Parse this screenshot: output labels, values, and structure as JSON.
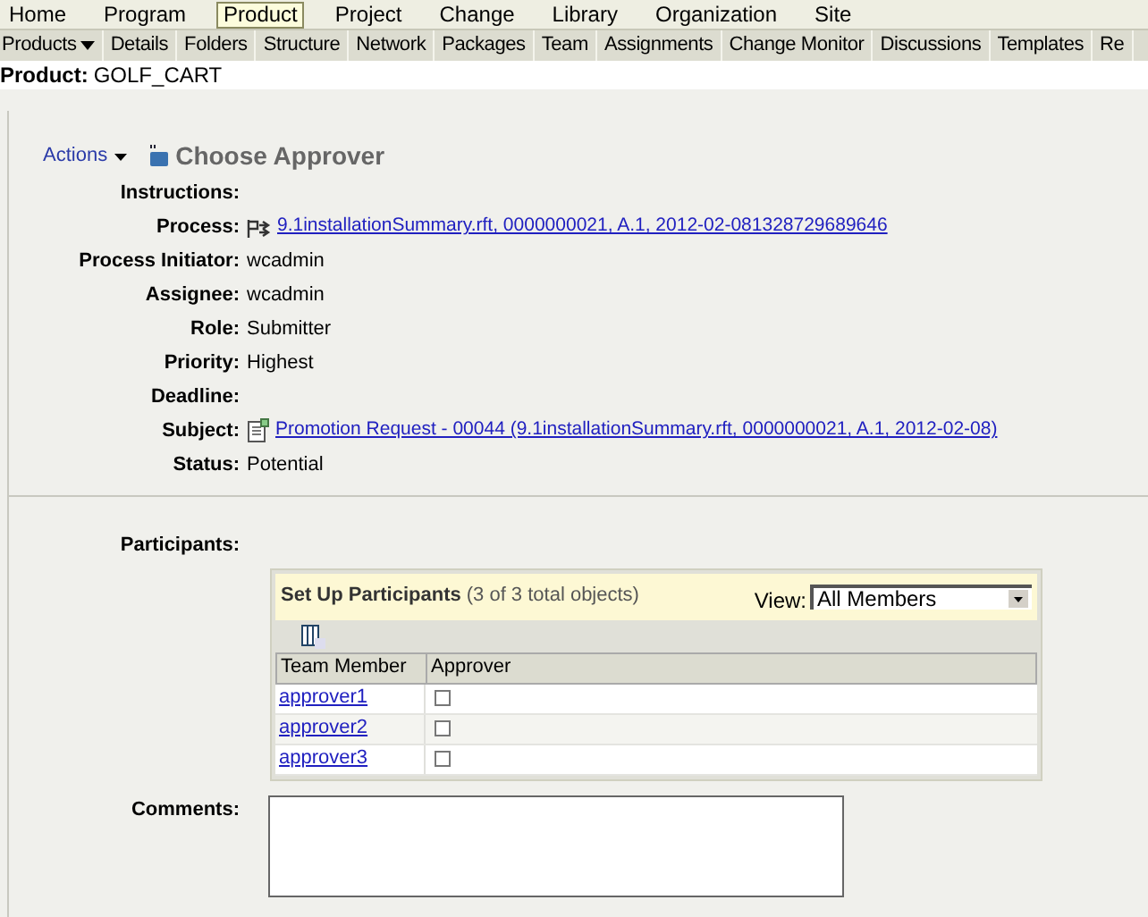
{
  "menu": [
    {
      "label": "Home",
      "selected": false
    },
    {
      "label": "Program",
      "selected": false
    },
    {
      "label": "Product",
      "selected": true
    },
    {
      "label": "Project",
      "selected": false
    },
    {
      "label": "Change",
      "selected": false
    },
    {
      "label": "Library",
      "selected": false
    },
    {
      "label": "Organization",
      "selected": false
    },
    {
      "label": "Site",
      "selected": false
    }
  ],
  "tabs": [
    {
      "label": "Products",
      "kind": "dropdown"
    },
    {
      "label": "Details",
      "kind": "tab"
    },
    {
      "label": "Folders",
      "kind": "tab"
    },
    {
      "label": "Structure",
      "kind": "tab"
    },
    {
      "label": "Network",
      "kind": "tab"
    },
    {
      "label": "Packages",
      "kind": "tab"
    },
    {
      "label": "Team",
      "kind": "tab"
    },
    {
      "label": "Assignments",
      "kind": "tab"
    },
    {
      "label": "Change Monitor",
      "kind": "tab"
    },
    {
      "label": "Discussions",
      "kind": "tab"
    },
    {
      "label": "Templates",
      "kind": "tab"
    },
    {
      "label": "Re",
      "kind": "tab"
    }
  ],
  "context": {
    "label": "Product:",
    "value": "GOLF_CART"
  },
  "actions": "Actions",
  "task_title": "Choose Approver",
  "fields": [
    {
      "label": "Instructions:",
      "kind": "text"
    },
    {
      "label": "Process:",
      "kind": "link",
      "value": "9.1installationSummary.rft, 0000000021, A.1, 2012-02-081328729689646"
    },
    {
      "label": "Process Initiator:",
      "kind": "text",
      "value": "wcadmin"
    },
    {
      "label": "Assignee:",
      "kind": "text",
      "value": "wcadmin"
    },
    {
      "label": "Role:",
      "kind": "text",
      "value": "Submitter"
    },
    {
      "label": "Priority:",
      "kind": "text",
      "value": "Highest"
    },
    {
      "label": "Deadline:",
      "kind": "text"
    },
    {
      "label": "Subject:",
      "kind": "doclink",
      "value": "Promotion Request - 00044 (9.1installationSummary.rft, 0000000021, A.1, 2012-02-08)"
    },
    {
      "label": "Status:",
      "kind": "text",
      "value": "Potential"
    }
  ],
  "participants": {
    "label": "Participants:",
    "title": "Set Up Participants",
    "count": "(3 of 3 total objects)",
    "view_label": "View:",
    "view_value": "All Members",
    "columns": [
      "Team Member",
      "Approver"
    ],
    "rows": [
      {
        "name": "approver1",
        "checked": false
      },
      {
        "name": "approver2",
        "checked": false
      },
      {
        "name": "approver3",
        "checked": false
      }
    ]
  },
  "comments": {
    "label": "Comments:"
  }
}
